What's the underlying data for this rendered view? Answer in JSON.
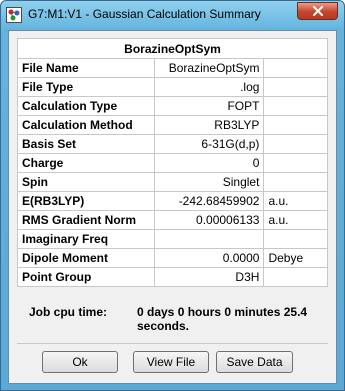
{
  "window": {
    "title": "G7:M1:V1 - Gaussian Calculation Summary"
  },
  "summary": {
    "header": "BorazineOptSym",
    "rows": [
      {
        "label": "File Name",
        "value": "BorazineOptSym",
        "unit": ""
      },
      {
        "label": "File Type",
        "value": ".log",
        "unit": ""
      },
      {
        "label": "Calculation Type",
        "value": "FOPT",
        "unit": ""
      },
      {
        "label": "Calculation Method",
        "value": "RB3LYP",
        "unit": ""
      },
      {
        "label": "Basis Set",
        "value": "6-31G(d,p)",
        "unit": ""
      },
      {
        "label": "Charge",
        "value": "0",
        "unit": ""
      },
      {
        "label": "Spin",
        "value": "Singlet",
        "unit": ""
      },
      {
        "label": "E(RB3LYP)",
        "value": "-242.68459902",
        "unit": "a.u."
      },
      {
        "label": "RMS Gradient Norm",
        "value": "0.00006133",
        "unit": "a.u."
      },
      {
        "label": "Imaginary Freq",
        "value": "",
        "unit": ""
      },
      {
        "label": "Dipole Moment",
        "value": "0.0000",
        "unit": "Debye"
      },
      {
        "label": "Point Group",
        "value": "D3H",
        "unit": ""
      }
    ]
  },
  "cpu": {
    "label": "Job cpu time:",
    "value": "0 days  0 hours  0 minutes 25.4 seconds."
  },
  "buttons": {
    "ok": "Ok",
    "view_file": "View File",
    "save_data": "Save Data"
  },
  "icons": {
    "app": "gaussview-app-icon",
    "close": "close-icon"
  },
  "colors": {
    "frame": "#63b3dd",
    "close": "#c6452c"
  }
}
